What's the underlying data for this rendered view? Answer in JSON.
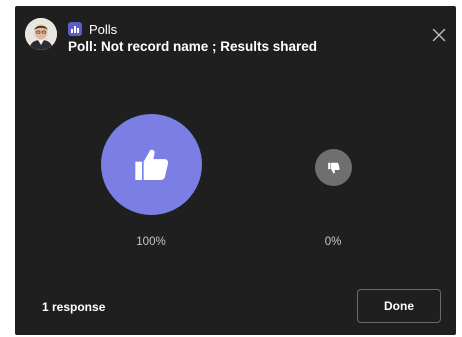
{
  "header": {
    "app_name": "Polls",
    "poll_title": "Poll: Not record name ; Results shared"
  },
  "results": {
    "options": [
      {
        "icon": "thumbs-up-icon",
        "percent_label": "100%",
        "share": 1.0,
        "color": "#7b7fe3"
      },
      {
        "icon": "thumbs-down-icon",
        "percent_label": "0%",
        "share": 0.0,
        "color": "#6f6f6f"
      }
    ]
  },
  "footer": {
    "response_count": "1 response",
    "done_label": "Done"
  },
  "colors": {
    "background": "#1f1f1f",
    "accent": "#5b5fc7"
  }
}
